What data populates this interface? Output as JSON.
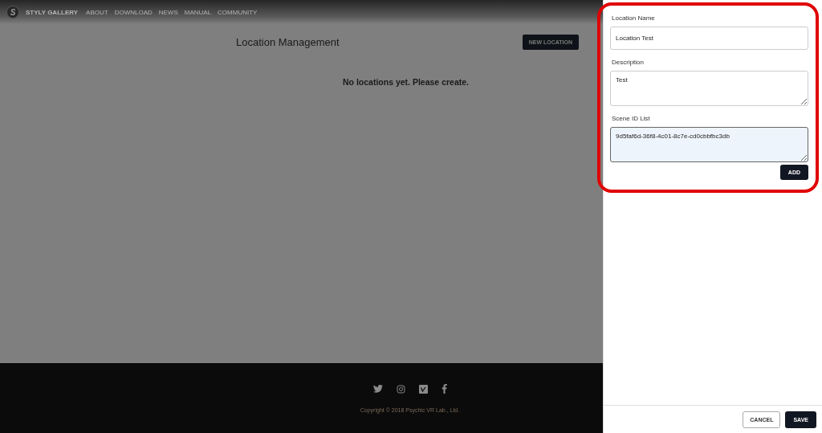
{
  "nav": {
    "brand": "STYLY GALLERY",
    "brand_mark": "S",
    "links": [
      "ABOUT",
      "DOWNLOAD",
      "NEWS",
      "MANUAL",
      "COMMUNITY"
    ]
  },
  "page": {
    "title": "Location Management",
    "new_button": "NEW LOCATION",
    "empty_message": "No locations yet. Please create."
  },
  "footer": {
    "copyright": "Copyright © 2018 Psychic VR Lab., Ltd."
  },
  "panel": {
    "fields": [
      {
        "label": "Location Name",
        "value": "Location Test",
        "kind": "input",
        "focused": false
      },
      {
        "label": "Description",
        "value": "Test",
        "kind": "textarea",
        "focused": false
      },
      {
        "label": "Scene ID List",
        "value": "9d5faf6d-36f8-4c01-8c7e-cd0cbbfbc3db",
        "kind": "textarea",
        "focused": true
      }
    ],
    "add_button": "ADD",
    "cancel_button": "CANCEL",
    "save_button": "SAVE"
  }
}
